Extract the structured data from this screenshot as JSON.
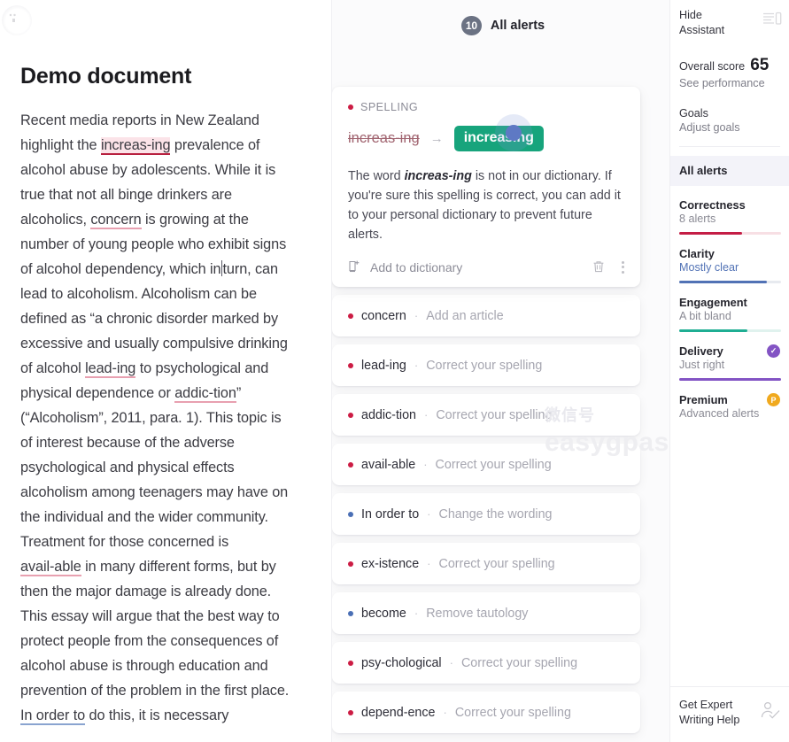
{
  "document": {
    "title": "Demo document",
    "paragraph_parts": [
      {
        "text": "Recent media reports in New Zealand highlight the ",
        "style": "plain"
      },
      {
        "text": "increas-ing",
        "style": "spell-active"
      },
      {
        "text": " prevalence of alcohol abuse by adolescents. While it is true that not all binge drinkers are alcoholics, ",
        "style": "plain"
      },
      {
        "text": "concern",
        "style": "spell"
      },
      {
        "text": " is growing at the number of young people who exhibit signs of alcohol dependency, which in",
        "style": "plain"
      },
      {
        "text": "",
        "style": "caret"
      },
      {
        "text": "turn, can lead to alcoholism. Alcoholism can be defined as “a chronic disorder marked by excessive and usually compulsive drinking of alcohol ",
        "style": "plain"
      },
      {
        "text": "lead-ing",
        "style": "spell"
      },
      {
        "text": " to psychological and physical dependence or ",
        "style": "plain"
      },
      {
        "text": "addic-tion",
        "style": "spell"
      },
      {
        "text": "” (“Alcoholism”, 2011, para. 1). This topic is of interest because of the adverse psychological and physical effects alcoholism among teenagers may have on the individual and the wider community. Treatment for those concerned is ",
        "style": "plain"
      },
      {
        "text": "avail-able",
        "style": "spell"
      },
      {
        "text": " in many different forms, but by then the major damage is already done. This essay will argue that the best way to protect people from the consequences of alcohol abuse is through education and prevention of the problem in the first place. ",
        "style": "plain"
      },
      {
        "text": "In order to",
        "style": "clarity"
      },
      {
        "text": " do this, it is necessary",
        "style": "plain"
      }
    ]
  },
  "alerts_panel": {
    "count": "10",
    "title": "All alerts",
    "main_card": {
      "category": "SPELLING",
      "category_color": "#cc1c44",
      "original": "increas-ing",
      "arrow": "→",
      "suggestion": "increasing",
      "explanation_prefix": "The word ",
      "explanation_word": "increas-ing",
      "explanation_suffix": " is not in our dictionary. If you're sure this spelling is correct, you can add it to your personal dictionary to prevent future alerts.",
      "add_to_dictionary_label": "Add to dictionary",
      "trash_icon": "trash-icon",
      "more_icon": "kebab-menu-icon"
    },
    "mini_cards": [
      {
        "word": "concern",
        "hint": "Add an article",
        "type": "correctness"
      },
      {
        "word": "lead-ing",
        "hint": "Correct your spelling",
        "type": "correctness"
      },
      {
        "word": "addic-tion",
        "hint": "Correct your spelling",
        "type": "correctness"
      },
      {
        "word": "avail-able",
        "hint": "Correct your spelling",
        "type": "correctness"
      },
      {
        "word": "In order to",
        "hint": "Change the wording",
        "type": "clarity"
      },
      {
        "word": "ex-istence",
        "hint": "Correct your spelling",
        "type": "correctness"
      },
      {
        "word": "become",
        "hint": "Remove tautology",
        "type": "clarity"
      },
      {
        "word": "psy-chological",
        "hint": "Correct your spelling",
        "type": "correctness"
      },
      {
        "word": "depend-ence",
        "hint": "Correct your spelling",
        "type": "correctness"
      }
    ],
    "separator": "·"
  },
  "sidebar": {
    "hide_assistant_label": "Hide\nAssistant",
    "panel_icon": "collapse-panel-icon",
    "overall_score_label": "Overall score",
    "overall_score_value": "65",
    "see_performance_label": "See performance",
    "goals_label": "Goals",
    "adjust_goals_label": "Adjust goals",
    "all_alerts_label": "All alerts",
    "metrics": [
      {
        "name": "Correctness",
        "status": "8 alerts",
        "percent": 62,
        "color": "#c41d45",
        "track": "#f7dfe4",
        "sub_color": "#8a8a94",
        "badge": ""
      },
      {
        "name": "Clarity",
        "status": "Mostly clear",
        "percent": 86,
        "color": "#5172b5",
        "track": "#e7eaef",
        "sub_color": "#5172b5",
        "badge": ""
      },
      {
        "name": "Engagement",
        "status": "A bit bland",
        "percent": 67,
        "color": "#1fae93",
        "track": "#e0f2ee",
        "sub_color": "#8a8a94",
        "badge": ""
      },
      {
        "name": "Delivery",
        "status": "Just right",
        "percent": 100,
        "color": "#8354c4",
        "track": "#ece4f6",
        "sub_color": "#8a8a94",
        "badge": "check"
      },
      {
        "name": "Premium",
        "status": "Advanced alerts",
        "percent": 0,
        "color": "#f0a91e",
        "track": "#ffffff",
        "sub_color": "#8a8a94",
        "badge": "premium"
      }
    ],
    "badge_check_glyph": "✓",
    "badge_premium_glyph": "P",
    "expert_label": "Get Expert\nWriting Help",
    "expert_icon": "person-check-icon"
  },
  "watermark": {
    "line1": "微信号",
    "line2": "easygpaschool"
  }
}
